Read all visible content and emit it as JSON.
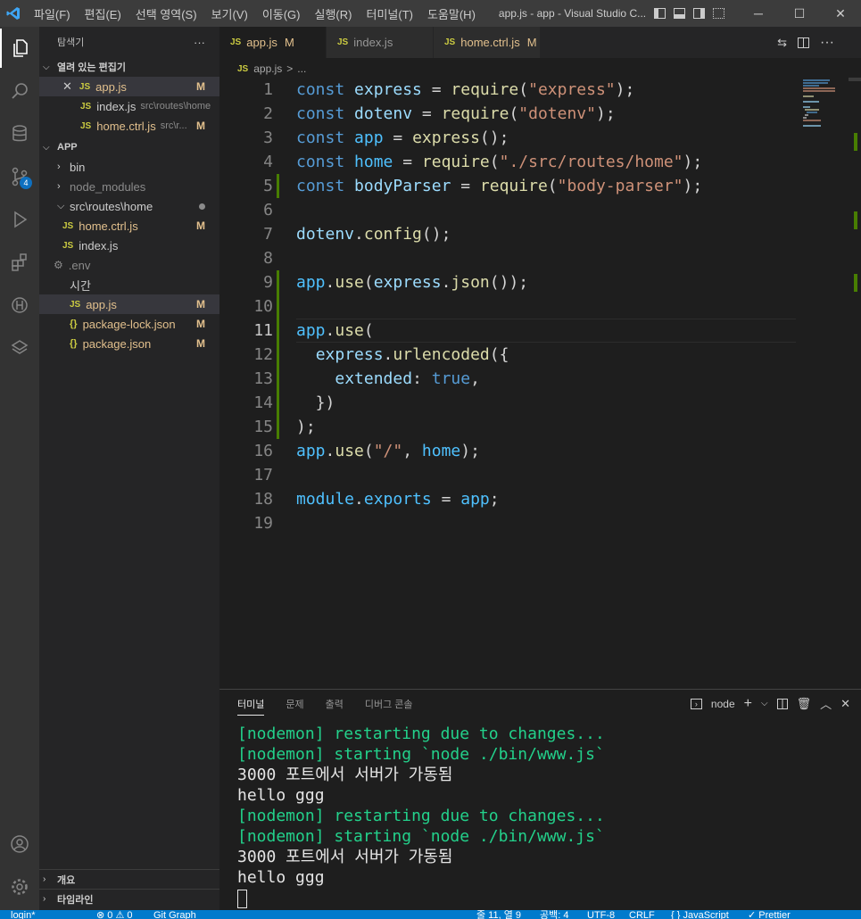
{
  "titlebar": {
    "menu": [
      "파일(F)",
      "편집(E)",
      "선택 영역(S)",
      "보기(V)",
      "이동(G)",
      "실행(R)",
      "터미널(T)",
      "도움말(H)"
    ],
    "title": "app.js - app - Visual Studio C..."
  },
  "activity": {
    "scm_badge": "4"
  },
  "explorer": {
    "title": "탐색기",
    "more": "···",
    "open_editors": {
      "header": "열려 있는 편집기",
      "items": [
        {
          "icon": "JS",
          "label": "app.js",
          "desc": "",
          "status": "M"
        },
        {
          "icon": "JS",
          "label": "index.js",
          "desc": "src\\routes\\home",
          "status": ""
        },
        {
          "icon": "JS",
          "label": "home.ctrl.js",
          "desc": "src\\r...",
          "status": "M"
        }
      ]
    },
    "folder": {
      "header": "APP",
      "items": [
        {
          "label": "bin"
        },
        {
          "label": "node_modules"
        },
        {
          "label": "src\\routes\\home"
        },
        {
          "icon": "JS",
          "label": "home.ctrl.js",
          "status": "M"
        },
        {
          "icon": "JS",
          "label": "index.js"
        },
        {
          "label": ".env"
        },
        {
          "label": "시간"
        },
        {
          "icon": "JS",
          "label": "app.js",
          "status": "M"
        },
        {
          "icon": "{}",
          "label": "package-lock.json",
          "status": "M"
        },
        {
          "icon": "{}",
          "label": "package.json",
          "status": "M"
        }
      ]
    },
    "outline": "개요",
    "timeline": "타임라인"
  },
  "tabs": [
    {
      "icon": "JS",
      "label": "app.js",
      "status": "M"
    },
    {
      "icon": "JS",
      "label": "index.js",
      "status": ""
    },
    {
      "icon": "JS",
      "label": "home.ctrl.js",
      "status": "M"
    }
  ],
  "breadcrumb": {
    "icon": "JS",
    "file": "app.js",
    "sep": ">",
    "rest": "..."
  },
  "code_lines": [
    "const express = require(\"express\");",
    "const dotenv = require(\"dotenv\");",
    "const app = express();",
    "const home = require(\"./src/routes/home\");",
    "const bodyParser = require(\"body-parser\");",
    "",
    "dotenv.config();",
    "",
    "app.use(express.json());",
    "",
    "app.use(",
    "  express.urlencoded({",
    "    extended: true,",
    "  })",
    ");",
    "app.use(\"/\", home);",
    "",
    "module.exports = app;",
    ""
  ],
  "panel": {
    "tabs": [
      "터미널",
      "문제",
      "출력",
      "디버그 콘솔"
    ],
    "shell": "node",
    "lines": [
      {
        "text": "[nodemon] restarting due to changes...",
        "kind": "green"
      },
      {
        "text": "[nodemon] starting `node ./bin/www.js`",
        "kind": "green"
      },
      {
        "text": "3000 포트에서 서버가 가동됨",
        "kind": "white"
      },
      {
        "text": "hello ggg",
        "kind": "white"
      },
      {
        "text": "[nodemon] restarting due to changes...",
        "kind": "green"
      },
      {
        "text": "[nodemon] starting `node ./bin/www.js`",
        "kind": "green"
      },
      {
        "text": "3000 포트에서 서버가 가동됨",
        "kind": "white"
      },
      {
        "text": "hello ggg",
        "kind": "white"
      }
    ]
  },
  "statusbar": {
    "branch": "login*",
    "problems": "⊗ 0 ⚠ 0",
    "git_graph": "Git Graph",
    "position": "줄 11, 열 9",
    "spaces": "공백: 4",
    "encoding": "UTF-8",
    "eol": "CRLF",
    "language": "{ } JavaScript",
    "prettier": "✓ Prettier"
  },
  "colors": {
    "accent": "#007acc",
    "modified": "#e2c08d",
    "js": "#cbcb41",
    "terminal_green": "#23d18b"
  }
}
